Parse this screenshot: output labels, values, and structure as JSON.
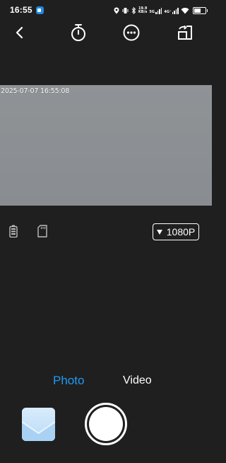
{
  "status_bar": {
    "time": "16:55",
    "net_speed_value": "19.9",
    "net_speed_unit": "KB/s",
    "sim1_label": "5G",
    "sim2_label": "4G⁺",
    "battery_level": 0.6
  },
  "toolbar": {
    "back": "back-icon",
    "timer": "timer-icon",
    "more": "more-icon",
    "switch_camera": "switch-camera-icon"
  },
  "preview": {
    "timestamp": "2025-07-07 16:55:08"
  },
  "device_status": {
    "resolution_label": "1080P"
  },
  "modes": {
    "photo_label": "Photo",
    "video_label": "Video",
    "active": "Photo"
  },
  "colors": {
    "background": "#1f1f1f",
    "accent": "#1e9af5",
    "preview": "#8d9195"
  }
}
